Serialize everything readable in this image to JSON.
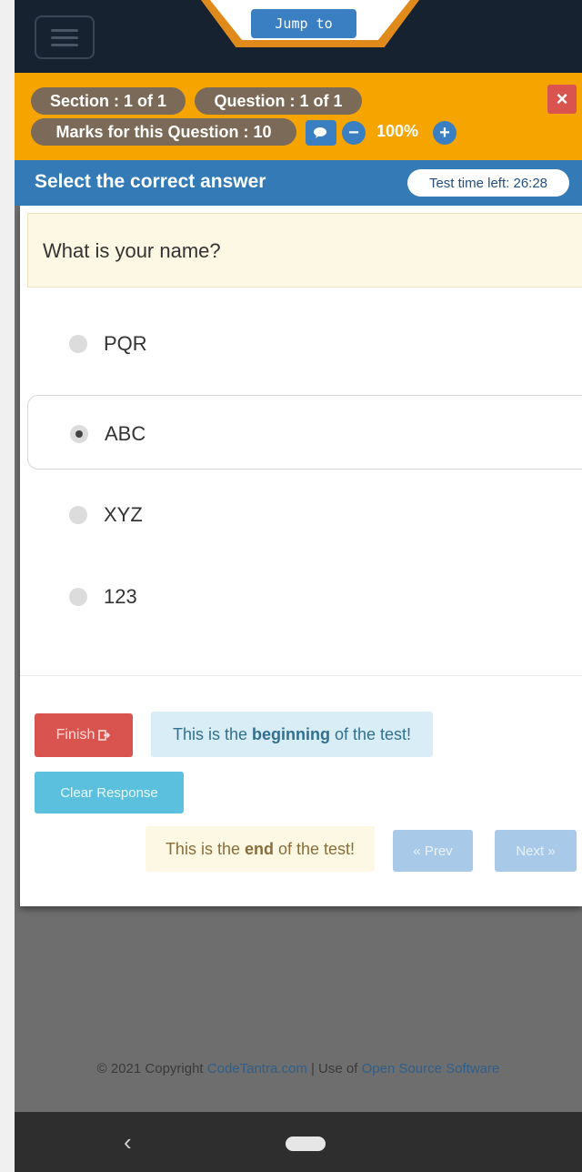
{
  "topnav": {
    "jump_label": "Jump to"
  },
  "header": {
    "section": "Section : 1 of 1",
    "question": "Question : 1 of 1",
    "marks": "Marks for this Question : 10",
    "zoom": "100%",
    "close": "×"
  },
  "bar": {
    "title": "Select the correct answer",
    "timer": "Test time left: 26:28"
  },
  "question": {
    "text": "What is your name?"
  },
  "options": [
    {
      "label": "PQR",
      "selected": false
    },
    {
      "label": "ABC",
      "selected": true
    },
    {
      "label": "XYZ",
      "selected": false
    },
    {
      "label": "123",
      "selected": false
    }
  ],
  "actions": {
    "finish": "Finish",
    "begin_pre": "This is the ",
    "begin_bold": "beginning",
    "begin_post": " of the test!",
    "clear": "Clear Response",
    "end_pre": "This is the ",
    "end_bold": "end",
    "end_post": " of the test!",
    "prev": "« Prev",
    "next": "Next »"
  },
  "footer": {
    "copyright": "© 2021 Copyright ",
    "site": "CodeTantra.com",
    "sep": " | Use of ",
    "oss": "Open Source Software"
  }
}
